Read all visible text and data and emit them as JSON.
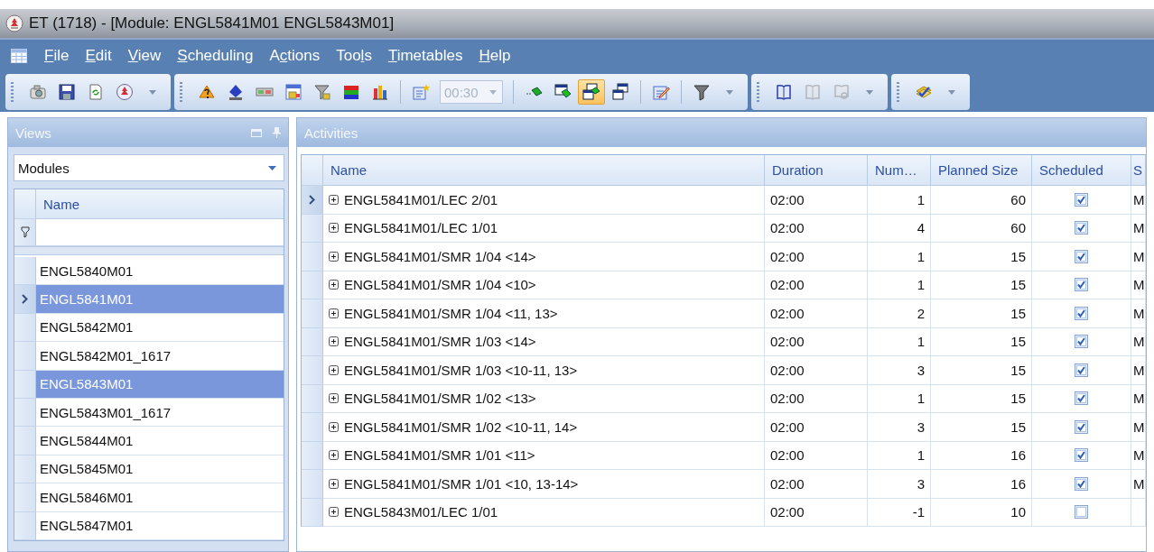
{
  "window": {
    "title": "ET (1718) - [Module: ENGL5841M01 ENGL5843M01]"
  },
  "menu": [
    {
      "key": "F",
      "post": "ile"
    },
    {
      "key": "E",
      "post": "dit"
    },
    {
      "key": "V",
      "post": "iew"
    },
    {
      "key": "S",
      "post": "cheduling"
    },
    {
      "pre": "A",
      "key": "c",
      "post": "tions"
    },
    {
      "pre": "Too",
      "key": "l",
      "post": "s"
    },
    {
      "key": "T",
      "post": "imetables"
    },
    {
      "key": "H",
      "post": "elp"
    }
  ],
  "toolbar": {
    "groups": [
      {
        "items": [
          {
            "kind": "button",
            "pressed": false,
            "disabled": false
          },
          {
            "kind": "button",
            "pressed": false,
            "disabled": false
          },
          {
            "kind": "button",
            "pressed": false,
            "disabled": false
          },
          {
            "kind": "button",
            "pressed": false,
            "disabled": false
          },
          {
            "kind": "caret"
          }
        ]
      },
      {
        "items": [
          {
            "kind": "button",
            "pressed": false,
            "disabled": false
          },
          {
            "kind": "button",
            "pressed": false,
            "disabled": false
          },
          {
            "kind": "button",
            "pressed": false,
            "disabled": false
          },
          {
            "kind": "button",
            "pressed": false,
            "disabled": false
          },
          {
            "kind": "button",
            "pressed": false,
            "disabled": false
          },
          {
            "kind": "button",
            "pressed": false,
            "disabled": false
          },
          {
            "kind": "button",
            "pressed": false,
            "disabled": false
          },
          {
            "kind": "separator"
          },
          {
            "kind": "button",
            "pressed": false,
            "disabled": false
          },
          {
            "kind": "time",
            "value": "00:30",
            "disabled": true
          },
          {
            "kind": "separator"
          },
          {
            "kind": "button",
            "pressed": false,
            "disabled": false
          },
          {
            "kind": "button",
            "pressed": false,
            "disabled": false
          },
          {
            "kind": "button",
            "pressed": true,
            "disabled": false
          },
          {
            "kind": "button",
            "pressed": false,
            "disabled": false
          },
          {
            "kind": "separator"
          },
          {
            "kind": "button",
            "pressed": false,
            "disabled": false
          },
          {
            "kind": "separator"
          },
          {
            "kind": "button",
            "pressed": false,
            "disabled": false
          },
          {
            "kind": "caret"
          }
        ]
      },
      {
        "items": [
          {
            "kind": "button",
            "pressed": false,
            "disabled": false
          },
          {
            "kind": "button",
            "pressed": false,
            "disabled": true
          },
          {
            "kind": "button",
            "pressed": false,
            "disabled": true
          },
          {
            "kind": "caret"
          }
        ]
      },
      {
        "items": [
          {
            "kind": "button",
            "pressed": false,
            "disabled": false
          },
          {
            "kind": "caret"
          }
        ]
      }
    ]
  },
  "views_panel": {
    "title": "Views",
    "view_select": {
      "value": "Modules"
    },
    "table": {
      "columns": [
        "Name"
      ],
      "rows": [
        {
          "name": "ENGL5840M01",
          "selected": false,
          "current": false
        },
        {
          "name": "ENGL5841M01",
          "selected": true,
          "current": true
        },
        {
          "name": "ENGL5842M01",
          "selected": false,
          "current": false
        },
        {
          "name": "ENGL5842M01_1617",
          "selected": false,
          "current": false
        },
        {
          "name": "ENGL5843M01",
          "selected": true,
          "current": false
        },
        {
          "name": "ENGL5843M01_1617",
          "selected": false,
          "current": false
        },
        {
          "name": "ENGL5844M01",
          "selected": false,
          "current": false
        },
        {
          "name": "ENGL5845M01",
          "selected": false,
          "current": false
        },
        {
          "name": "ENGL5846M01",
          "selected": false,
          "current": false
        },
        {
          "name": "ENGL5847M01",
          "selected": false,
          "current": false
        }
      ]
    }
  },
  "activities_panel": {
    "title": "Activities",
    "table": {
      "columns": [
        "Name",
        "Duration",
        "Num…",
        "Planned Size",
        "Scheduled",
        "S"
      ],
      "rows": [
        {
          "name": "ENGL5841M01/LEC 2/01",
          "duration": "02:00",
          "number": "1",
          "planned_size": "60",
          "scheduled": true,
          "column_6": "M",
          "current": true
        },
        {
          "name": "ENGL5841M01/LEC 1/01",
          "duration": "02:00",
          "number": "4",
          "planned_size": "60",
          "scheduled": true,
          "column_6": "M",
          "current": false
        },
        {
          "name": "ENGL5841M01/SMR 1/04 <14>",
          "duration": "02:00",
          "number": "1",
          "planned_size": "15",
          "scheduled": true,
          "column_6": "M",
          "current": false
        },
        {
          "name": "ENGL5841M01/SMR 1/04 <10>",
          "duration": "02:00",
          "number": "1",
          "planned_size": "15",
          "scheduled": true,
          "column_6": "M",
          "current": false
        },
        {
          "name": "ENGL5841M01/SMR 1/04 <11, 13>",
          "duration": "02:00",
          "number": "2",
          "planned_size": "15",
          "scheduled": true,
          "column_6": "M",
          "current": false
        },
        {
          "name": "ENGL5841M01/SMR 1/03 <14>",
          "duration": "02:00",
          "number": "1",
          "planned_size": "15",
          "scheduled": true,
          "column_6": "M",
          "current": false
        },
        {
          "name": "ENGL5841M01/SMR 1/03 <10-11, 13>",
          "duration": "02:00",
          "number": "3",
          "planned_size": "15",
          "scheduled": true,
          "column_6": "M",
          "current": false
        },
        {
          "name": "ENGL5841M01/SMR 1/02 <13>",
          "duration": "02:00",
          "number": "1",
          "planned_size": "15",
          "scheduled": true,
          "column_6": "M",
          "current": false
        },
        {
          "name": "ENGL5841M01/SMR 1/02 <10-11, 14>",
          "duration": "02:00",
          "number": "3",
          "planned_size": "15",
          "scheduled": true,
          "column_6": "M",
          "current": false
        },
        {
          "name": "ENGL5841M01/SMR 1/01 <11>",
          "duration": "02:00",
          "number": "1",
          "planned_size": "16",
          "scheduled": true,
          "column_6": "M",
          "current": false
        },
        {
          "name": "ENGL5841M01/SMR 1/01 <10, 13-14>",
          "duration": "02:00",
          "number": "3",
          "planned_size": "16",
          "scheduled": true,
          "column_6": "M",
          "current": false
        },
        {
          "name": "ENGL5843M01/LEC 1/01",
          "duration": "02:00",
          "number": "-1",
          "planned_size": "10",
          "scheduled": false,
          "current": false
        }
      ]
    }
  }
}
